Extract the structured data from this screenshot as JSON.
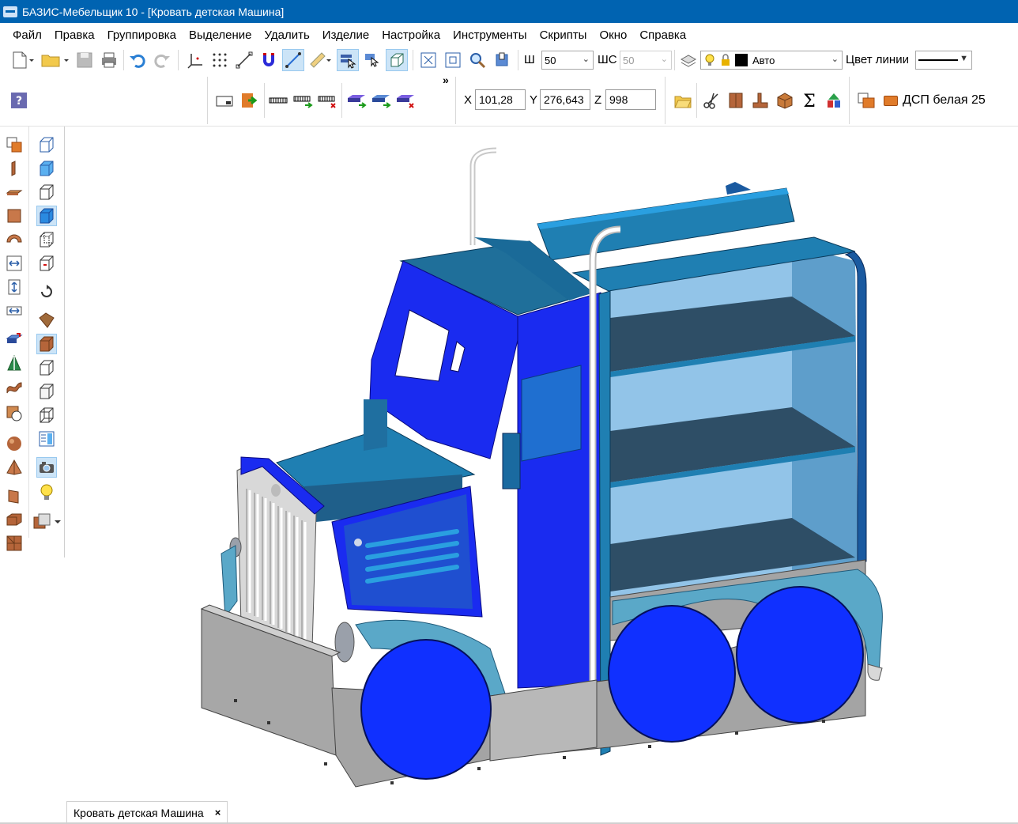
{
  "window": {
    "title": "БАЗИС-Мебельщик 10 - [Кровать детская Машина]"
  },
  "menu": [
    "Файл",
    "Правка",
    "Группировка",
    "Выделение",
    "Удалить",
    "Изделие",
    "Настройка",
    "Инструменты",
    "Скрипты",
    "Окно",
    "Справка"
  ],
  "toolbar": {
    "sh_label": "Ш",
    "sh_value": "50",
    "shs_label": "ШС",
    "shs_value": "50",
    "line_style_value": "Авто",
    "line_color_label": "Цвет линии",
    "overflow_glyph": "»"
  },
  "coords": {
    "x_label": "X",
    "x_value": "101,28",
    "y_label": "Y",
    "y_value": "276,643",
    "z_label": "Z",
    "z_value": "998"
  },
  "material": {
    "name": "ДСП белая 25"
  },
  "colors": {
    "titlebar": "#0063b1",
    "cab_blue": "#1a2bf0",
    "teal": "#1f7fb2",
    "wheel": "#1030ff",
    "shelf_back": "#92c4e8"
  },
  "document_tab": {
    "label": "Кровать детская Машина",
    "close_glyph": "×"
  }
}
